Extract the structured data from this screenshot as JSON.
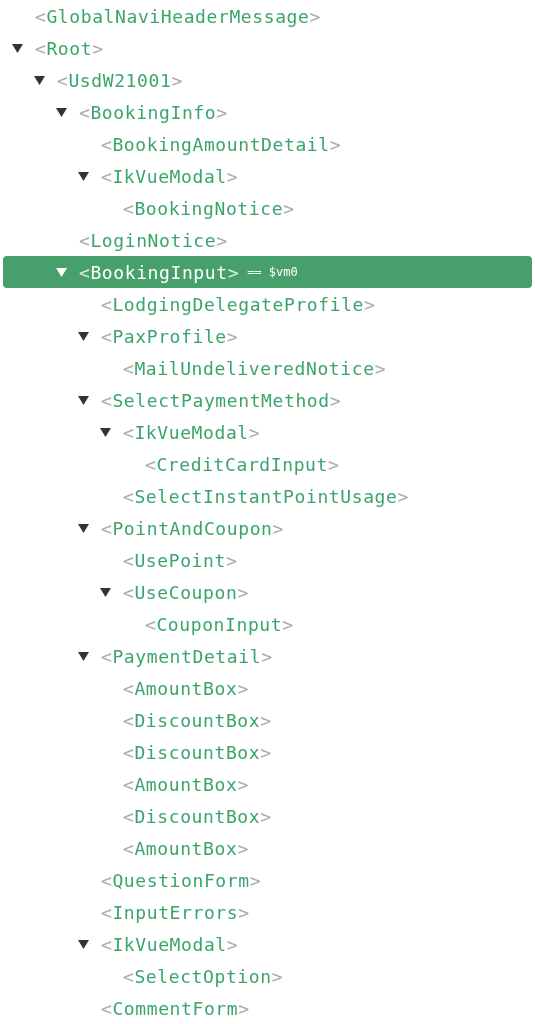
{
  "tree": [
    {
      "open": "<",
      "name": "GlobalNaviHeaderMessage",
      "close": ">",
      "selected": false
    },
    {
      "open": "<",
      "name": "Root",
      "close": ">",
      "selected": false,
      "expanded": true,
      "children": [
        {
          "open": "<",
          "name": "UsdW21001",
          "close": ">",
          "selected": false,
          "expanded": true,
          "children": [
            {
              "open": "<",
              "name": "BookingInfo",
              "close": ">",
              "selected": false,
              "expanded": true,
              "children": [
                {
                  "open": "<",
                  "name": "BookingAmountDetail",
                  "close": ">",
                  "selected": false
                },
                {
                  "open": "<",
                  "name": "IkVueModal",
                  "close": ">",
                  "selected": false,
                  "expanded": true,
                  "children": [
                    {
                      "open": "<",
                      "name": "BookingNotice",
                      "close": ">",
                      "selected": false
                    }
                  ]
                }
              ]
            },
            {
              "open": "<",
              "name": "LoginNotice",
              "close": ">",
              "selected": false
            },
            {
              "open": "<",
              "name": "BookingInput",
              "close": ">",
              "note": "== $vm0",
              "selected": true,
              "expanded": true,
              "children": [
                {
                  "open": "<",
                  "name": "LodgingDelegateProfile",
                  "close": ">",
                  "selected": false
                },
                {
                  "open": "<",
                  "name": "PaxProfile",
                  "close": ">",
                  "selected": false,
                  "expanded": true,
                  "children": [
                    {
                      "open": "<",
                      "name": "MailUndeliveredNotice",
                      "close": ">",
                      "selected": false
                    }
                  ]
                },
                {
                  "open": "<",
                  "name": "SelectPaymentMethod",
                  "close": ">",
                  "selected": false,
                  "expanded": true,
                  "children": [
                    {
                      "open": "<",
                      "name": "IkVueModal",
                      "close": ">",
                      "selected": false,
                      "expanded": true,
                      "children": [
                        {
                          "open": "<",
                          "name": "CreditCardInput",
                          "close": ">",
                          "selected": false
                        }
                      ]
                    },
                    {
                      "open": "<",
                      "name": "SelectInstantPointUsage",
                      "close": ">",
                      "selected": false
                    }
                  ]
                },
                {
                  "open": "<",
                  "name": "PointAndCoupon",
                  "close": ">",
                  "selected": false,
                  "expanded": true,
                  "children": [
                    {
                      "open": "<",
                      "name": "UsePoint",
                      "close": ">",
                      "selected": false
                    },
                    {
                      "open": "<",
                      "name": "UseCoupon",
                      "close": ">",
                      "selected": false,
                      "expanded": true,
                      "children": [
                        {
                          "open": "<",
                          "name": "CouponInput",
                          "close": ">",
                          "selected": false
                        }
                      ]
                    }
                  ]
                },
                {
                  "open": "<",
                  "name": "PaymentDetail",
                  "close": ">",
                  "selected": false,
                  "expanded": true,
                  "children": [
                    {
                      "open": "<",
                      "name": "AmountBox",
                      "close": ">",
                      "selected": false
                    },
                    {
                      "open": "<",
                      "name": "DiscountBox",
                      "close": ">",
                      "selected": false
                    },
                    {
                      "open": "<",
                      "name": "DiscountBox",
                      "close": ">",
                      "selected": false
                    },
                    {
                      "open": "<",
                      "name": "AmountBox",
                      "close": ">",
                      "selected": false
                    },
                    {
                      "open": "<",
                      "name": "DiscountBox",
                      "close": ">",
                      "selected": false
                    },
                    {
                      "open": "<",
                      "name": "AmountBox",
                      "close": ">",
                      "selected": false
                    }
                  ]
                },
                {
                  "open": "<",
                  "name": "QuestionForm",
                  "close": ">",
                  "selected": false
                },
                {
                  "open": "<",
                  "name": "InputErrors",
                  "close": ">",
                  "selected": false
                },
                {
                  "open": "<",
                  "name": "IkVueModal",
                  "close": ">",
                  "selected": false,
                  "expanded": true,
                  "children": [
                    {
                      "open": "<",
                      "name": "SelectOption",
                      "close": ">",
                      "selected": false
                    }
                  ]
                },
                {
                  "open": "<",
                  "name": "CommentForm",
                  "close": ">",
                  "selected": false
                }
              ]
            }
          ]
        }
      ]
    }
  ]
}
